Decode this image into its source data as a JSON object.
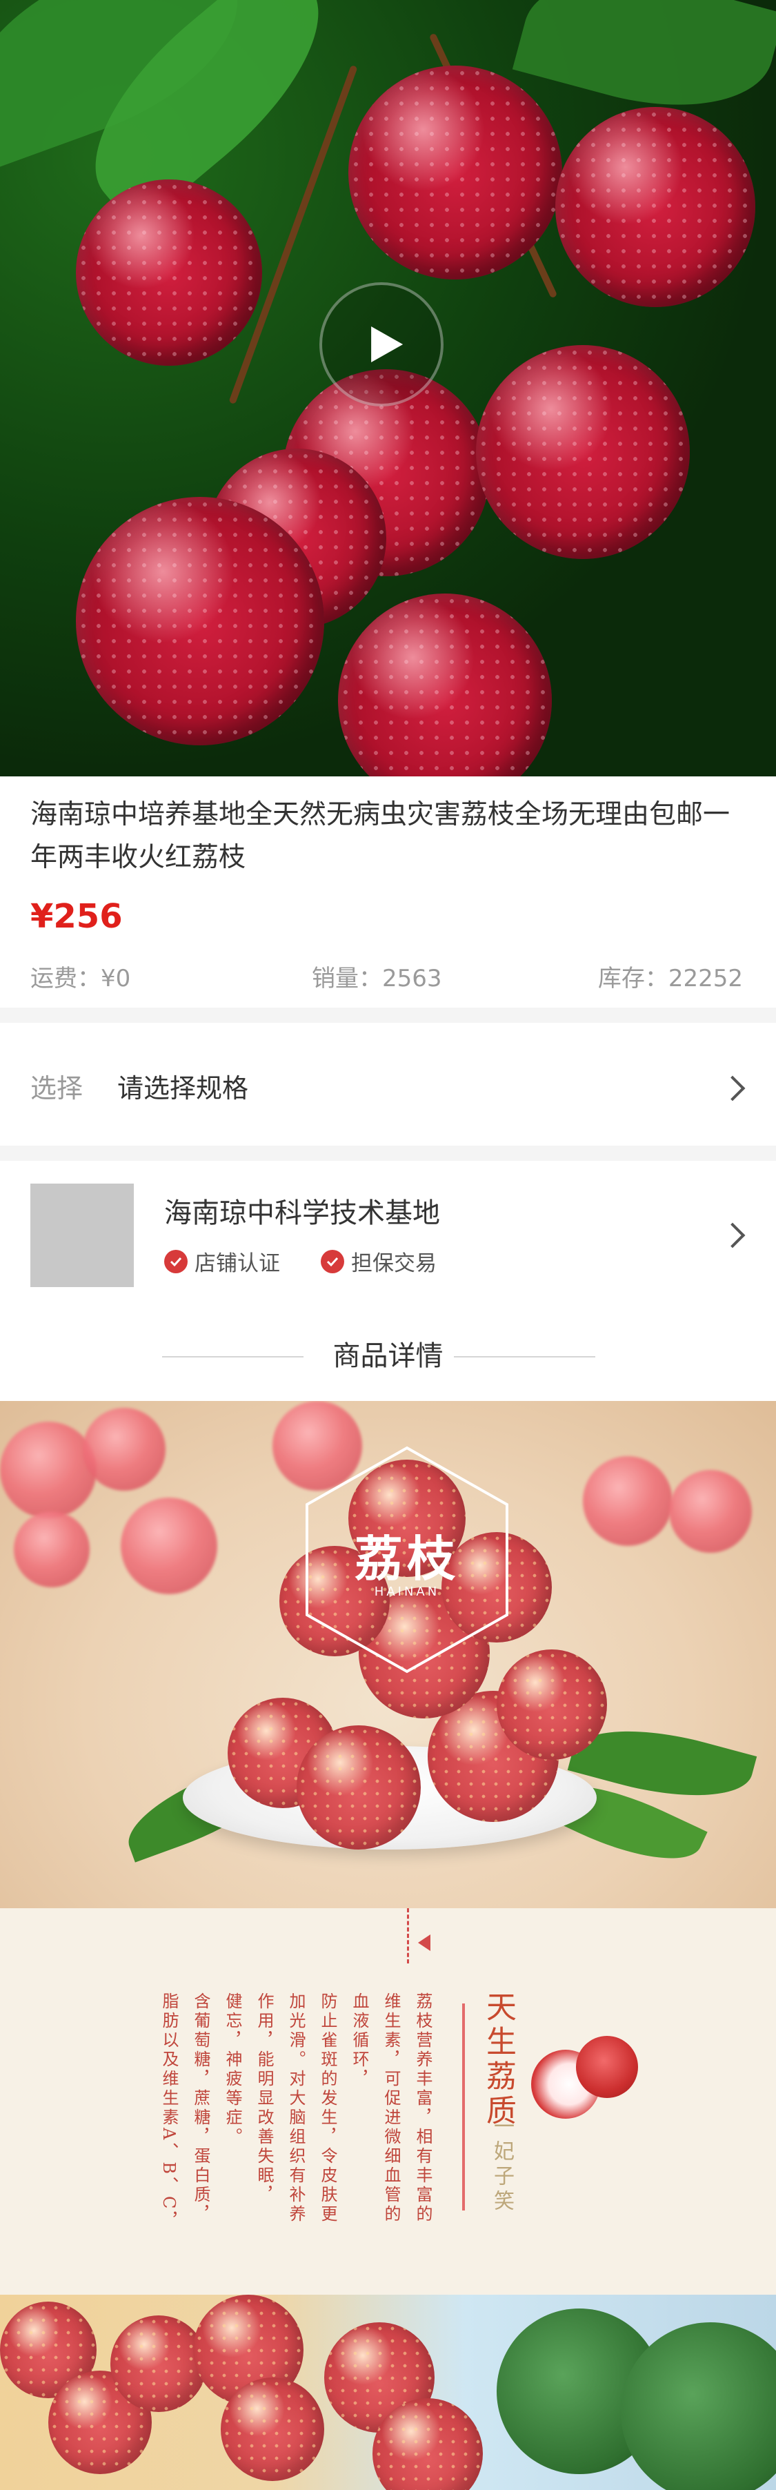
{
  "product": {
    "title": "海南琼中培养基地全天然无病虫灾害荔枝全场无理由包邮一年两丰收火红荔枝",
    "price": "¥256",
    "shipping": "运费：¥0",
    "sales": "销量：2563",
    "stock": "库存：22252"
  },
  "spec": {
    "label": "选择",
    "value": "请选择规格"
  },
  "shop": {
    "name": "海南琼中科学技术基地",
    "badges": [
      "店铺认证",
      "担保交易"
    ]
  },
  "details": {
    "heading": "商品详情",
    "logo_title": "荔枝",
    "logo_sub": "HAINAN",
    "poem_title": "天生荔质",
    "poem_sub": "一妃子笑",
    "poem_columns": [
      "荔枝营养丰富，相有丰富的",
      "维生素，可促进微细血管的",
      "血液循环，",
      "防止雀斑的发生，令皮肤更",
      "加光滑。对大脑组织有补养",
      "作用，能明显改善失眠，",
      "健忘，神疲等症。",
      "含葡萄糖，蔗糖，蛋白质，",
      "脂肪以及维生素A、B、C，"
    ]
  },
  "colors": {
    "price": "#e0201b",
    "accent_red": "#d34a4a",
    "muted_text": "#9a9a9a"
  },
  "icons": {
    "play": "play-icon",
    "chevron": "chevron-right-icon",
    "check": "check-circle-icon"
  }
}
